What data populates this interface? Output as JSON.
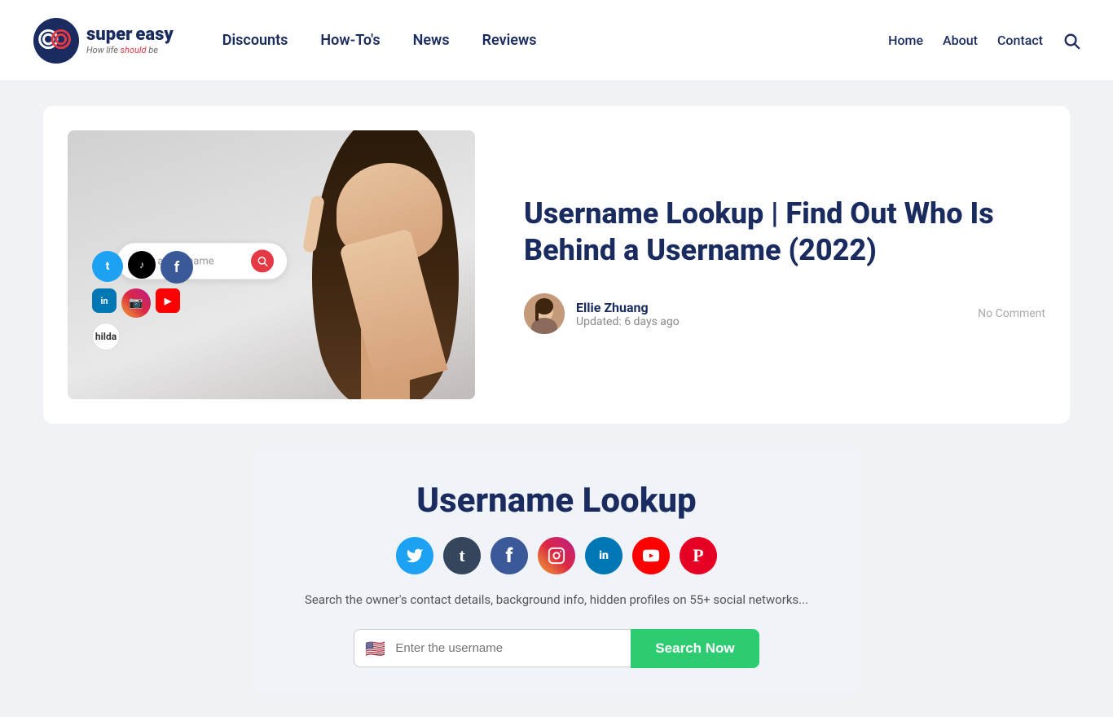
{
  "header": {
    "logo": {
      "super": "super",
      "easy": "easy",
      "tagline_prefix": "How life ",
      "tagline_highlight": "should",
      "tagline_suffix": " be"
    },
    "nav": {
      "items": [
        {
          "label": "Discounts",
          "id": "discounts"
        },
        {
          "label": "How-To's",
          "id": "howtos"
        },
        {
          "label": "News",
          "id": "news"
        },
        {
          "label": "Reviews",
          "id": "reviews"
        }
      ]
    },
    "right_nav": {
      "items": [
        {
          "label": "Home",
          "id": "home"
        },
        {
          "label": "About",
          "id": "about"
        },
        {
          "label": "Contact",
          "id": "contact"
        }
      ]
    }
  },
  "article": {
    "title": "Username Lookup | Find Out Who Is Behind a Username (2022)",
    "author": {
      "name": "Ellie Zhuang",
      "updated": "Updated: 6 days ago"
    },
    "no_comment": "No Comment",
    "image_search_placeholder": "Enter a Username"
  },
  "lookup_section": {
    "title": "Username Lookup",
    "description": "Search the owner's contact details, background info, hidden profiles on 55+ social networks...",
    "input_placeholder": "Enter the username",
    "search_button": "Search Now",
    "social_icons": [
      {
        "name": "twitter",
        "symbol": "t",
        "class": "si-twitter"
      },
      {
        "name": "tumblr",
        "symbol": "t",
        "class": "si-tumblr"
      },
      {
        "name": "facebook",
        "symbol": "f",
        "class": "si-facebook"
      },
      {
        "name": "instagram",
        "symbol": "📷",
        "class": "si-instagram"
      },
      {
        "name": "linkedin",
        "symbol": "in",
        "class": "si-linkedin"
      },
      {
        "name": "youtube",
        "symbol": "▶",
        "class": "si-youtube"
      },
      {
        "name": "pinterest",
        "symbol": "P",
        "class": "si-pinterest"
      }
    ]
  },
  "colors": {
    "brand_dark": "#1a2b5f",
    "brand_red": "#e63946",
    "search_green": "#2ecc71"
  }
}
